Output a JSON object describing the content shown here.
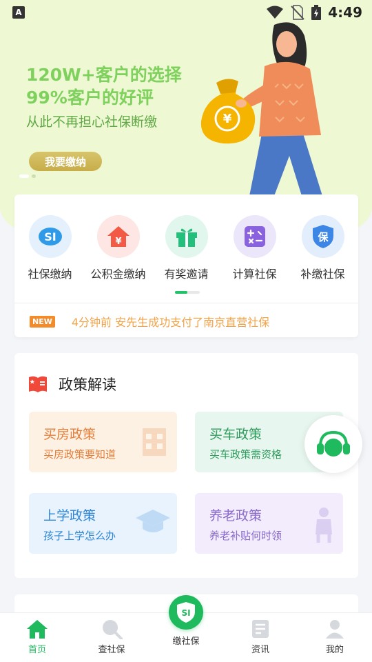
{
  "status_bar": {
    "time": "4:49"
  },
  "banner": {
    "headline_line1": "120W+客户的选择",
    "headline_line2": "99%客户的好评",
    "tagline": "从此不再担心社保断缴",
    "cta_label": "我要缴纳"
  },
  "quick_menu": {
    "items": [
      {
        "label": "社保缴纳",
        "icon": "si-icon"
      },
      {
        "label": "公积金缴纳",
        "icon": "house-yuan-icon"
      },
      {
        "label": "有奖邀请",
        "icon": "gift-icon"
      },
      {
        "label": "计算社保",
        "icon": "calculator-icon"
      },
      {
        "label": "补缴社保",
        "icon": "shield-bao-icon"
      }
    ]
  },
  "ticker": {
    "badge": "NEW",
    "text": "4分钟前 安先生成功支付了南京直营社保"
  },
  "policy": {
    "title": "政策解读",
    "tiles": [
      {
        "title": "买房政策",
        "subtitle": "买房政策要知道"
      },
      {
        "title": "买车政策",
        "subtitle": "买车政策需资格"
      },
      {
        "title": "上学政策",
        "subtitle": "孩子上学怎么办"
      },
      {
        "title": "养老政策",
        "subtitle": "养老补贴何时领"
      }
    ]
  },
  "tab_bar": {
    "tabs": [
      {
        "label": "首页"
      },
      {
        "label": "查社保"
      },
      {
        "label": "缴社保"
      },
      {
        "label": "资讯"
      },
      {
        "label": "我的"
      }
    ],
    "center_badge": "SI"
  },
  "colors": {
    "brand_green": "#1fb95e",
    "banner_bg": "#eef8d2",
    "ticker_orange": "#f2a348"
  }
}
